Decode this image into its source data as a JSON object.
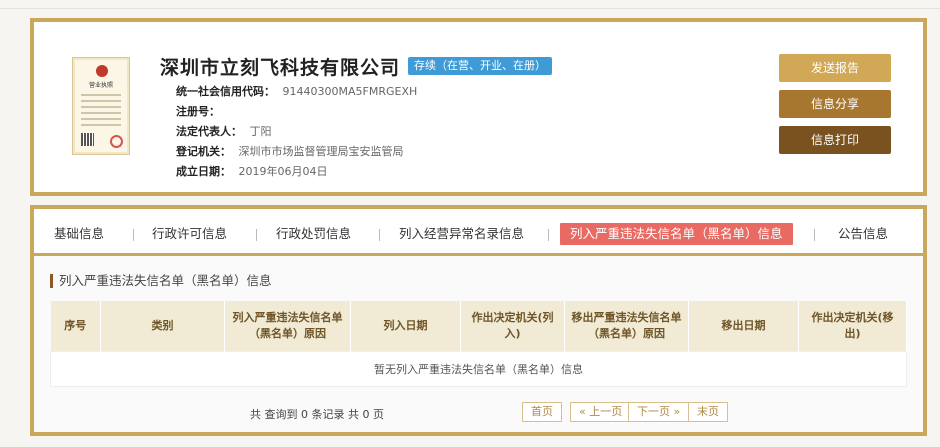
{
  "company": {
    "name": "深圳市立刻飞科技有限公司",
    "status": "存续（在营、开业、在册）",
    "fields": [
      {
        "label": "统一社会信用代码：",
        "value": "91440300MA5FMRGEXH"
      },
      {
        "label": "注册号：",
        "value": ""
      },
      {
        "label": "法定代表人：",
        "value": "丁阳"
      },
      {
        "label": "登记机关：",
        "value": "深圳市市场监督管理局宝安监管局"
      },
      {
        "label": "成立日期：",
        "value": "2019年06月04日"
      }
    ],
    "license_title": "营业执照"
  },
  "actions": {
    "report": "发送报告",
    "share": "信息分享",
    "print": "信息打印"
  },
  "tabs": [
    "基础信息",
    "行政许可信息",
    "行政处罚信息",
    "列入经营异常名录信息",
    "列入严重违法失信名单（黑名单）信息",
    "公告信息"
  ],
  "section": {
    "title": "列入严重违法失信名单（黑名单）信息",
    "columns": [
      "序号",
      "类别",
      "列入严重违法失信名单（黑名单）原因",
      "列入日期",
      "作出决定机关(列入)",
      "移出严重违法失信名单（黑名单）原因",
      "移出日期",
      "作出决定机关(移出)"
    ],
    "empty_text": "暂无列入严重违法失信名单（黑名单）信息"
  },
  "pagination": {
    "summary": "共 查询到 0 条记录 共 0 页",
    "first": "首页",
    "prev": "« 上一页",
    "next": "下一页 »",
    "last": "末页"
  },
  "colors": {
    "accent_gold": "#c9a85c",
    "status_blue": "#3f9bd6",
    "active_tab_red": "#e96a63"
  }
}
